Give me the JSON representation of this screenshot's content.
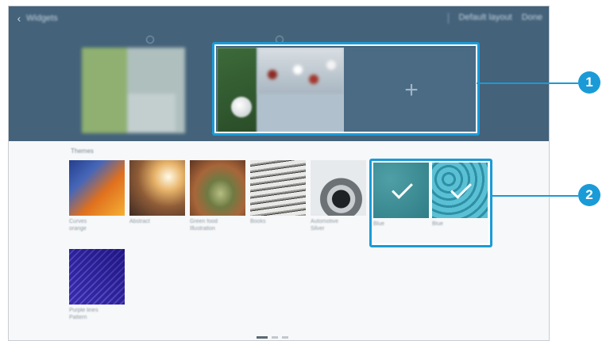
{
  "actionbar": {
    "back_icon": "chevron-left-icon",
    "title": "Widgets",
    "actions": [
      "Default layout",
      "Done"
    ]
  },
  "home_panels": [
    {
      "type": "preview"
    },
    {
      "type": "preview",
      "selected": true
    },
    {
      "type": "add",
      "icon": "plus-icon",
      "label": "+"
    }
  ],
  "content": {
    "section_label": "Themes",
    "tiles": [
      {
        "caption_1": "Curves",
        "caption_2": "orange",
        "selected": false
      },
      {
        "caption_1": "Abstract",
        "caption_2": "",
        "selected": false
      },
      {
        "caption_1": "Green food",
        "caption_2": "Illustration",
        "selected": false
      },
      {
        "caption_1": "Books",
        "caption_2": "",
        "selected": false
      },
      {
        "caption_1": "Automotive",
        "caption_2": "Silver",
        "selected": false
      },
      {
        "caption_1": "Blue",
        "caption_2": "",
        "selected": true
      },
      {
        "caption_1": "Blue",
        "caption_2": "",
        "selected": true
      },
      {
        "caption_1": "Purple lines",
        "caption_2": "Pattern",
        "selected": false
      }
    ]
  },
  "callouts": [
    "1",
    "2"
  ],
  "colors": {
    "header": "#44627a",
    "callout": "#1a9bd7"
  }
}
